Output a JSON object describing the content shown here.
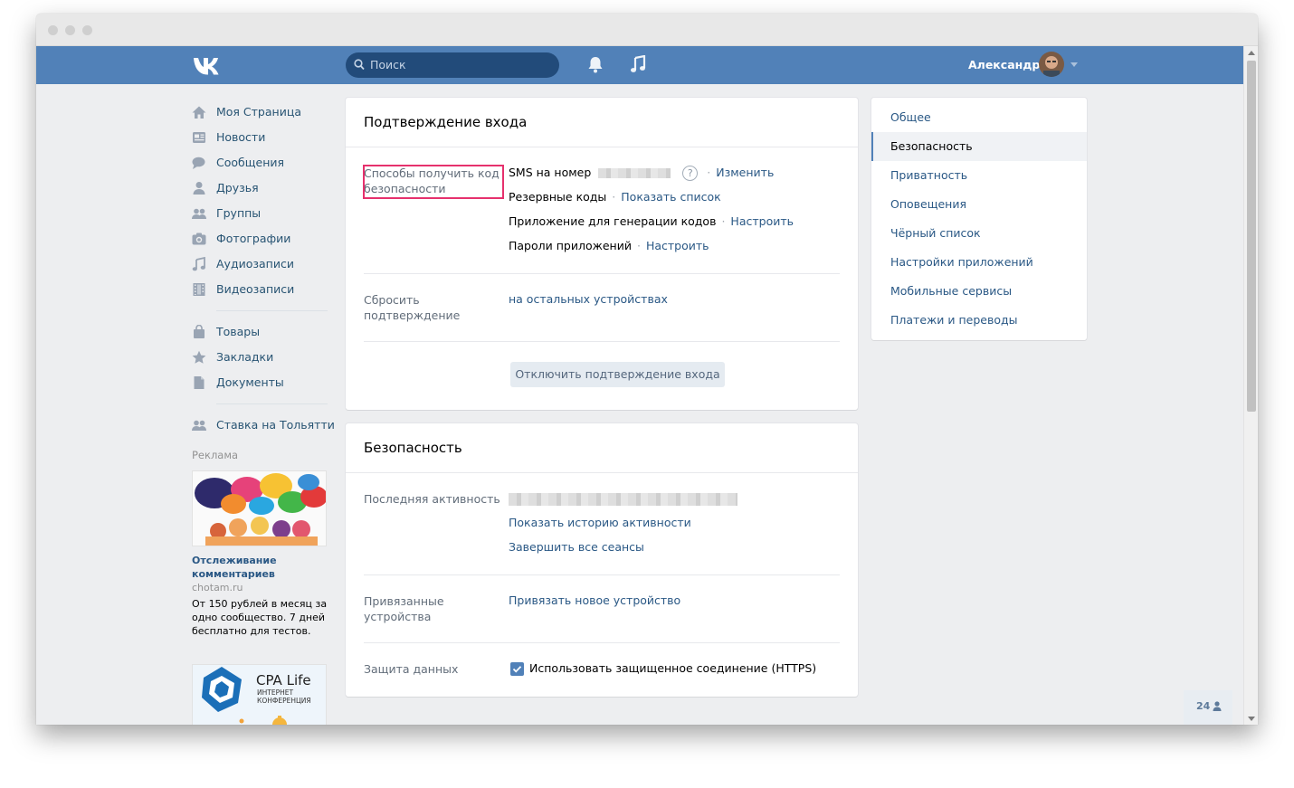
{
  "header": {
    "search_placeholder": "Поиск",
    "user_name": "Александр"
  },
  "sidebar": {
    "items": [
      {
        "label": "Моя Страница",
        "icon": "home-icon"
      },
      {
        "label": "Новости",
        "icon": "news-icon"
      },
      {
        "label": "Сообщения",
        "icon": "messages-icon"
      },
      {
        "label": "Друзья",
        "icon": "friends-icon"
      },
      {
        "label": "Группы",
        "icon": "groups-icon"
      },
      {
        "label": "Фотографии",
        "icon": "camera-icon"
      },
      {
        "label": "Аудиозаписи",
        "icon": "music-note-icon"
      },
      {
        "label": "Видеозаписи",
        "icon": "film-icon"
      }
    ],
    "items2": [
      {
        "label": "Товары",
        "icon": "bag-icon"
      },
      {
        "label": "Закладки",
        "icon": "star-icon"
      },
      {
        "label": "Документы",
        "icon": "document-icon"
      }
    ],
    "items3": [
      {
        "label": "Ставка на Тольятти",
        "icon": "group-icon"
      }
    ]
  },
  "ads": {
    "title": "Реклама",
    "ad1": {
      "title": "Отслеживание комментариев",
      "domain": "chotam.ru",
      "description": "От 150 рублей в месяц за одно сообщество. 7 дней бесплатно для тестов."
    },
    "ad2": {
      "brand": "CPA Life",
      "subtitle_1": "ИНТЕРНЕТ",
      "subtitle_2": "КОНФЕРЕНЦИЯ"
    }
  },
  "login_confirm": {
    "title": "Подтверждение входа",
    "methods_label": "Способы получить код безопасности",
    "sms_label": "SMS на номер",
    "sms_link": "Изменить",
    "backup_label": "Резервные коды",
    "backup_link": "Показать список",
    "app_label": "Приложение для генерации кодов",
    "app_link": "Настроить",
    "passwords_label": "Пароли приложений",
    "passwords_link": "Настроить",
    "reset_label": "Сбросить подтверждение",
    "reset_link": "на остальных устройствах",
    "disable_button": "Отключить подтверждение входа"
  },
  "security": {
    "title": "Безопасность",
    "activity_label": "Последняя активность",
    "history_link": "Показать историю активности",
    "end_sessions_link": "Завершить все сеансы",
    "devices_label": "Привязанные устройства",
    "devices_link": "Привязать новое устройство",
    "data_label": "Защита данных",
    "https_label": "Использовать защищенное соединение (HTTPS)",
    "https_checked": true
  },
  "settings_menu": {
    "items": [
      "Общее",
      "Безопасность",
      "Приватность",
      "Оповещения",
      "Чёрный список",
      "Настройки приложений",
      "Мобильные сервисы",
      "Платежи и переводы"
    ],
    "active": "Безопасность"
  },
  "online_count": "24",
  "colors": {
    "header": "#5181b8",
    "link": "#2a5885",
    "highlight": "#e6316d"
  }
}
